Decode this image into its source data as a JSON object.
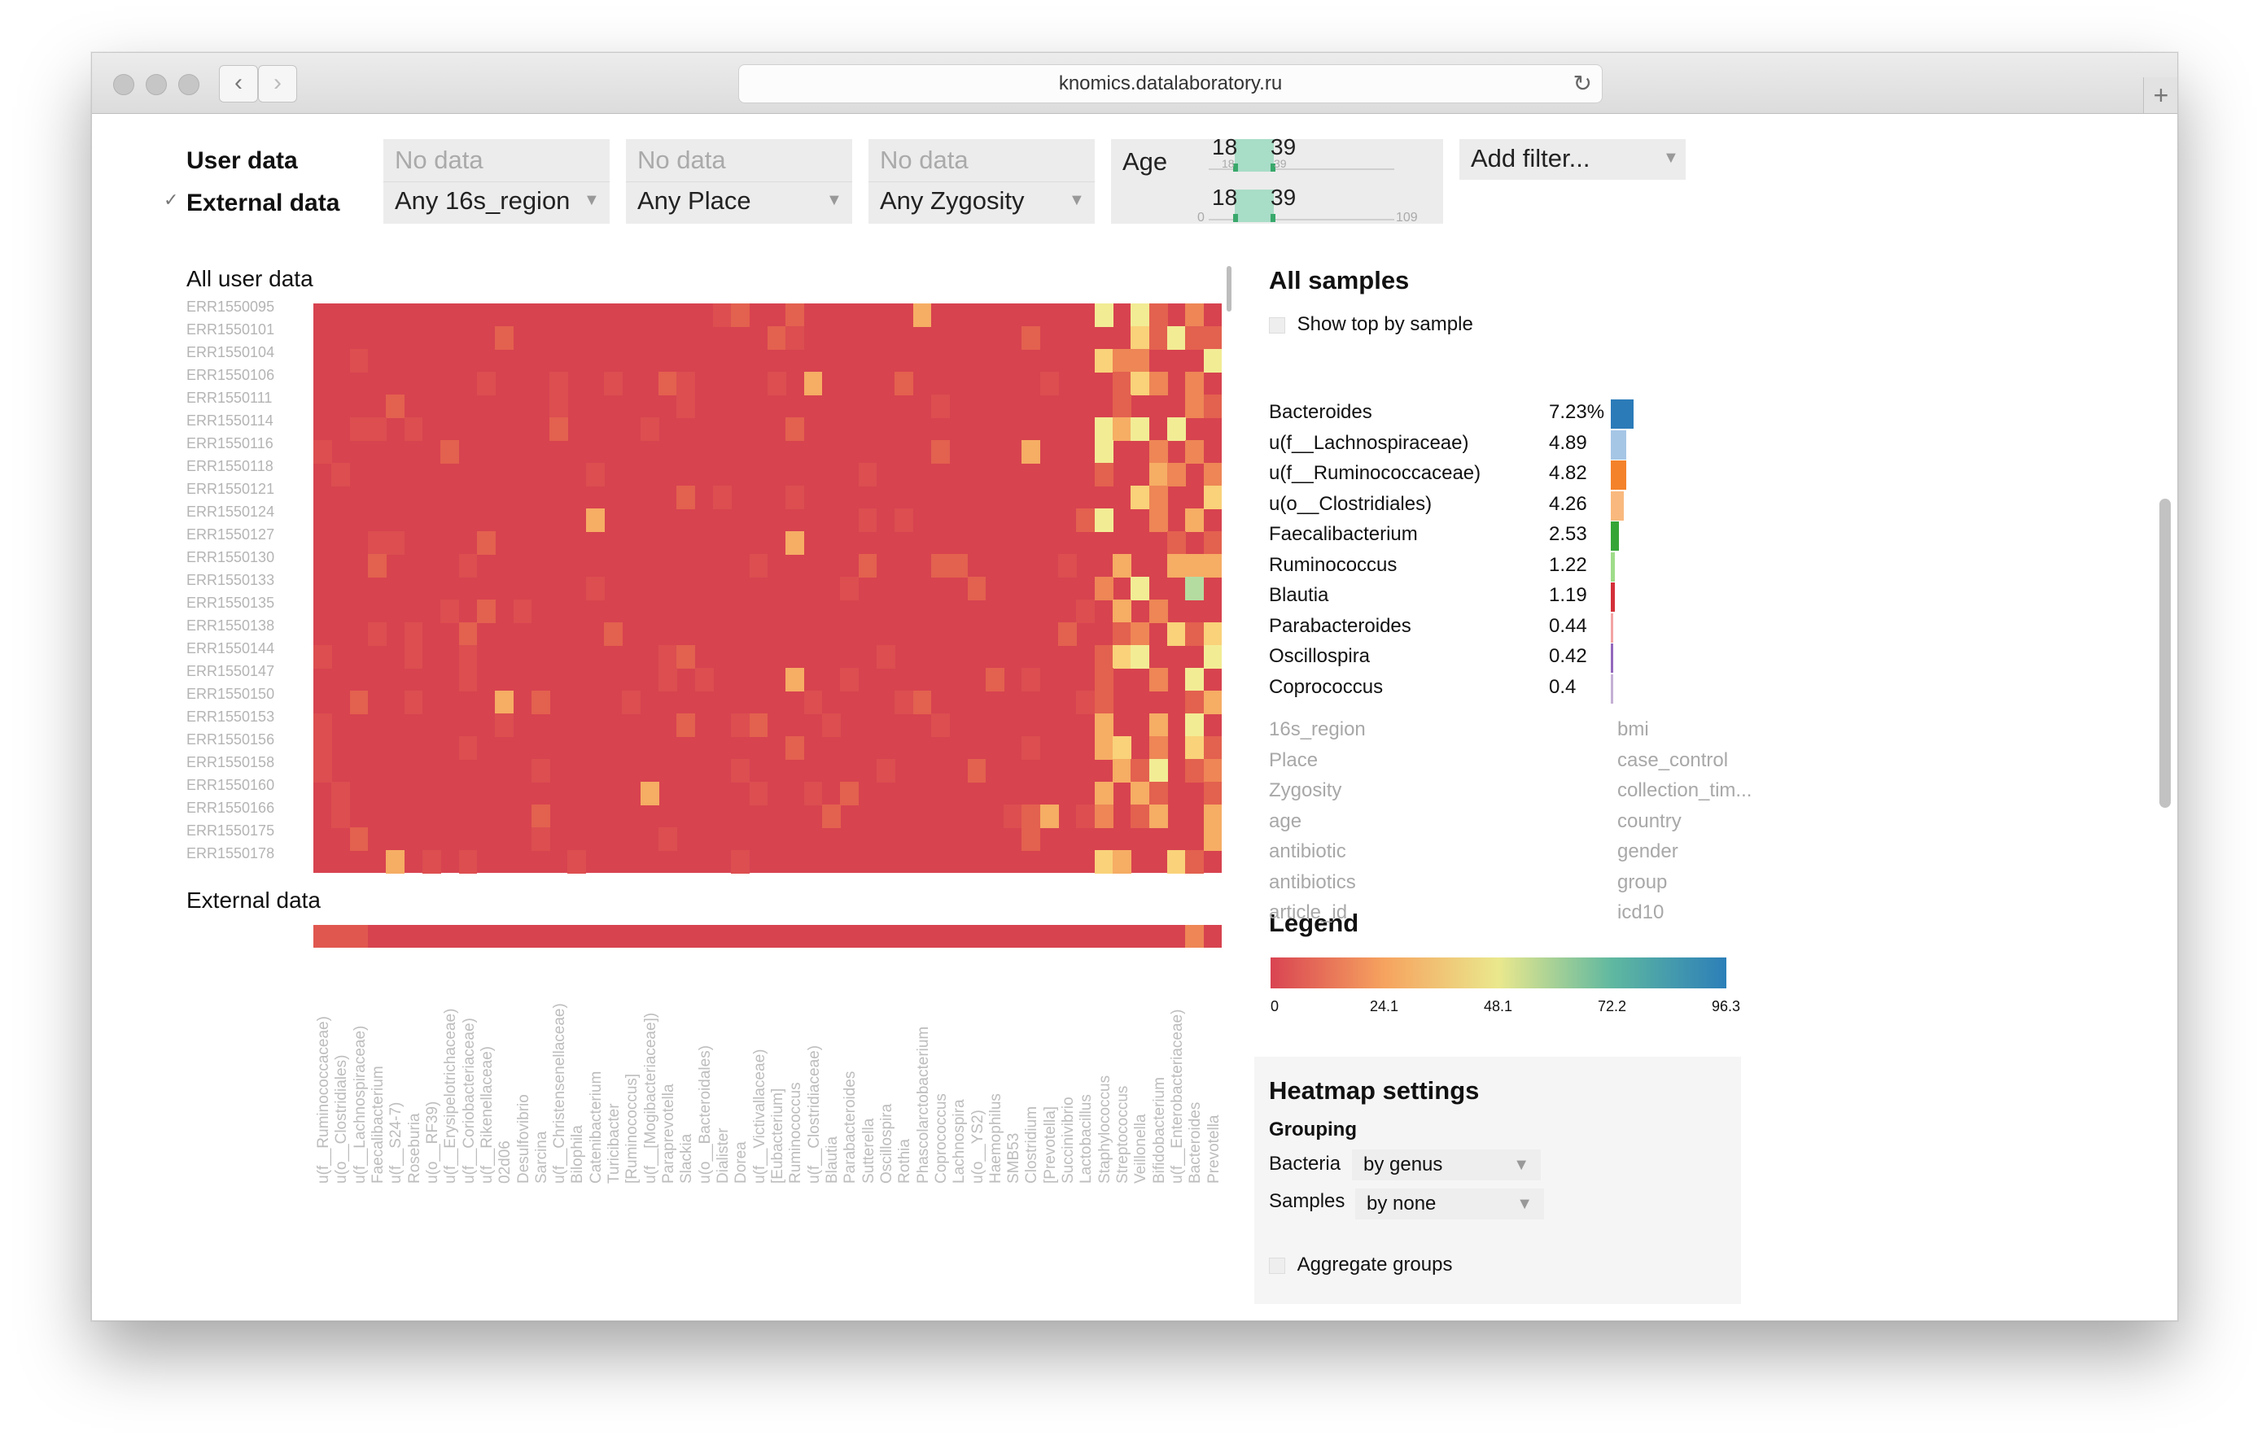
{
  "browser": {
    "url": "knomics.datalaboratory.ru",
    "new_tab": "+"
  },
  "filters": {
    "user_data_label": "User data",
    "external_data_label": "External data",
    "checkmark": "✓",
    "no_data": "No data",
    "region": "Any 16s_region",
    "place": "Any Place",
    "zygosity": "Any Zygosity",
    "age_label": "Age",
    "age_user_min": "18",
    "age_user_max": "39",
    "age_user_min_small": "18",
    "age_user_max_small": "39",
    "age_ext_min": "18",
    "age_ext_max": "39",
    "age_axis_min": "0",
    "age_axis_max": "109",
    "add_filter": "Add filter..."
  },
  "heatmap": {
    "user_title": "All user data",
    "external_title": "External data",
    "rows": [
      "ERR1550095",
      "ERR1550101",
      "ERR1550104",
      "ERR1550106",
      "ERR1550111",
      "ERR1550114",
      "ERR1550116",
      "ERR1550118",
      "ERR1550121",
      "ERR1550124",
      "ERR1550127",
      "ERR1550130",
      "ERR1550133",
      "ERR1550135",
      "ERR1550138",
      "ERR1550144",
      "ERR1550147",
      "ERR1550150",
      "ERR1550153",
      "ERR1550156",
      "ERR1550158",
      "ERR1550160",
      "ERR1550166",
      "ERR1550175",
      "ERR1550178"
    ],
    "columns": [
      "u(f__Ruminococcaceae)",
      "u(o__Clostridiales)",
      "u(f__Lachnospiraceae)",
      "Faecalibacterium",
      "u(f__S24-7)",
      "Roseburia",
      "u(o__RF39)",
      "u(f__Erysipelotrichaceae)",
      "u(f__Coriobacteriaceae)",
      "u(f__Rikenellaceae)",
      "02d06",
      "Desulfovibrio",
      "Sarcina",
      "u(f__Christensenellaceae)",
      "Bilophila",
      "Catenibacterium",
      "Turicibacter",
      "[Ruminococcus]",
      "u(f__[Mogibacteriaceae])",
      "Paraprevotella",
      "Slackia",
      "u(o__Bacteroidales)",
      "Dialister",
      "Dorea",
      "u(f__Victivallaceae)",
      "[Eubacterium]",
      "Ruminococcus",
      "u(f__Clostridiaceae)",
      "Blautia",
      "Parabacteroides",
      "Sutterella",
      "Oscillospira",
      "Rothia",
      "Phascolarctobacterium",
      "Coprococcus",
      "Lachnospira",
      "u(o__YS2)",
      "Haemophilus",
      "SMB53",
      "Clostridium",
      "[Prevotella]",
      "Succinivibrio",
      "Lactobacillus",
      "Staphylococcus",
      "Streptococcus",
      "Veillonella",
      "Bifidobacterium",
      "u(f__Enterobacteriaceae)",
      "Bacteroides",
      "Prevotella"
    ]
  },
  "samples": {
    "title": "All samples",
    "show_top": "Show top by sample",
    "items": [
      {
        "name": "Bacteroides",
        "value": "7.23%",
        "v": 7.23,
        "color": "#2b7bb9"
      },
      {
        "name": "u(f__Lachnospiraceae)",
        "value": "4.89",
        "v": 4.89,
        "color": "#a6c6e6"
      },
      {
        "name": "u(f__Ruminococcaceae)",
        "value": "4.82",
        "v": 4.82,
        "color": "#f4822a"
      },
      {
        "name": "u(o__Clostridiales)",
        "value": "4.26",
        "v": 4.26,
        "color": "#f9b97e"
      },
      {
        "name": "Faecalibacterium",
        "value": "2.53",
        "v": 2.53,
        "color": "#35a537"
      },
      {
        "name": "Ruminococcus",
        "value": "1.22",
        "v": 1.22,
        "color": "#9fdc8a"
      },
      {
        "name": "Blautia",
        "value": "1.19",
        "v": 1.19,
        "color": "#d4303a"
      },
      {
        "name": "Parabacteroides",
        "value": "0.44",
        "v": 0.44,
        "color": "#f3a3a3"
      },
      {
        "name": "Oscillospira",
        "value": "0.42",
        "v": 0.42,
        "color": "#9468bd"
      },
      {
        "name": "Coprococcus",
        "value": "0.4",
        "v": 0.4,
        "color": "#c5b0d5"
      }
    ],
    "meta_left": [
      "16s_region",
      "Place",
      "Zygosity",
      "age",
      "antibiotic",
      "antibiotics",
      "article_id"
    ],
    "meta_right": [
      "bmi",
      "case_control",
      "collection_tim...",
      "country",
      "gender",
      "group",
      "icd10"
    ]
  },
  "legend": {
    "title": "Legend",
    "ticks": [
      "0",
      "24.1",
      "48.1",
      "72.2",
      "96.3"
    ],
    "colors": [
      "#d94452",
      "#f6a35f",
      "#eae88d",
      "#5fb8a0",
      "#2c7fb8"
    ]
  },
  "settings": {
    "title": "Heatmap settings",
    "grouping": "Grouping",
    "bacteria_label": "Bacteria",
    "bacteria_value": "by genus",
    "samples_label": "Samples",
    "samples_value": "by none",
    "aggregate": "Aggregate groups"
  }
}
